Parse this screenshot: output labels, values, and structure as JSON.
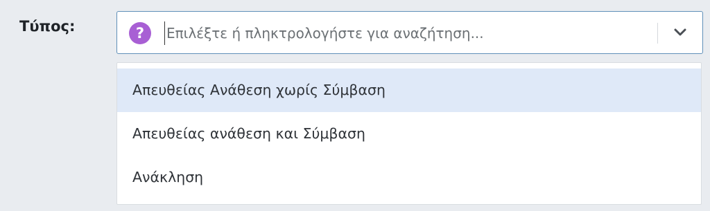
{
  "field": {
    "label": "Τύπος:"
  },
  "select": {
    "help_icon": "question-circle-icon",
    "help_glyph": "?",
    "placeholder": "Επιλέξτε ή πληκτρολογήστε για αναζήτηση...",
    "value": "",
    "toggle_icon": "chevron-down-icon",
    "accent_color": "#a85fd4",
    "border_color": "#5f8fb8"
  },
  "menu": {
    "highlight_color": "#dfe9f8",
    "options": [
      {
        "label": "Απευθείας Ανάθεση χωρίς Σύμβαση",
        "highlighted": true
      },
      {
        "label": "Απευθείας ανάθεση και Σύμβαση",
        "highlighted": false
      },
      {
        "label": "Ανάκληση",
        "highlighted": false
      }
    ]
  }
}
